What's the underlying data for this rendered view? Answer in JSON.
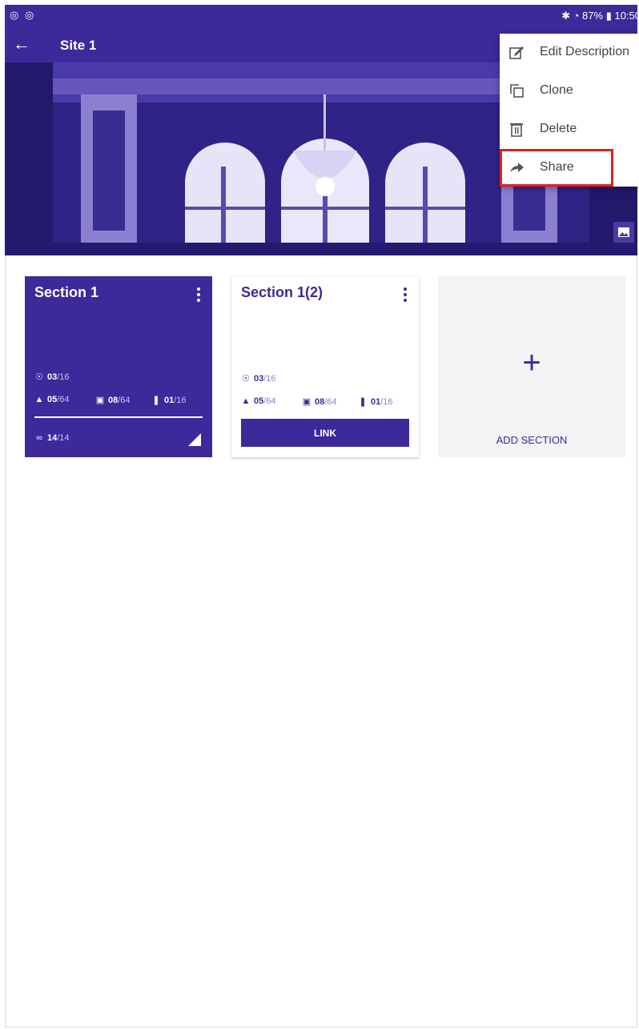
{
  "status_bar": {
    "left_icons": "◎ ◎",
    "right_text": "✱ ◔ 87% ▮ 10:50"
  },
  "app_bar": {
    "title": "Site 1"
  },
  "menu": {
    "items": [
      {
        "label": "Edit Description",
        "icon": "edit-icon"
      },
      {
        "label": "Clone",
        "icon": "clone-icon"
      },
      {
        "label": "Delete",
        "icon": "delete-icon"
      },
      {
        "label": "Share",
        "icon": "share-icon"
      }
    ],
    "highlighted": "Share"
  },
  "sections": [
    {
      "title": "Section 1",
      "sensors": {
        "num": "03",
        "den": "/16"
      },
      "lights": {
        "num": "05",
        "den": "/64"
      },
      "switches": {
        "num": "08",
        "den": "/64"
      },
      "audio": {
        "num": "01",
        "den": "/16"
      },
      "links": {
        "num": "14",
        "den": "/14"
      }
    },
    {
      "title": "Section 1(2)",
      "sensors": {
        "num": "03",
        "den": "/16"
      },
      "lights": {
        "num": "05",
        "den": "/64"
      },
      "switches": {
        "num": "08",
        "den": "/64"
      },
      "audio": {
        "num": "01",
        "den": "/16"
      },
      "link_button": "LINK"
    }
  ],
  "add_section": {
    "plus": "+",
    "label": "ADD SECTION"
  },
  "colors": {
    "primary": "#3b2a9a",
    "highlight": "#e02020",
    "card_bg": "#f3f3f3"
  }
}
